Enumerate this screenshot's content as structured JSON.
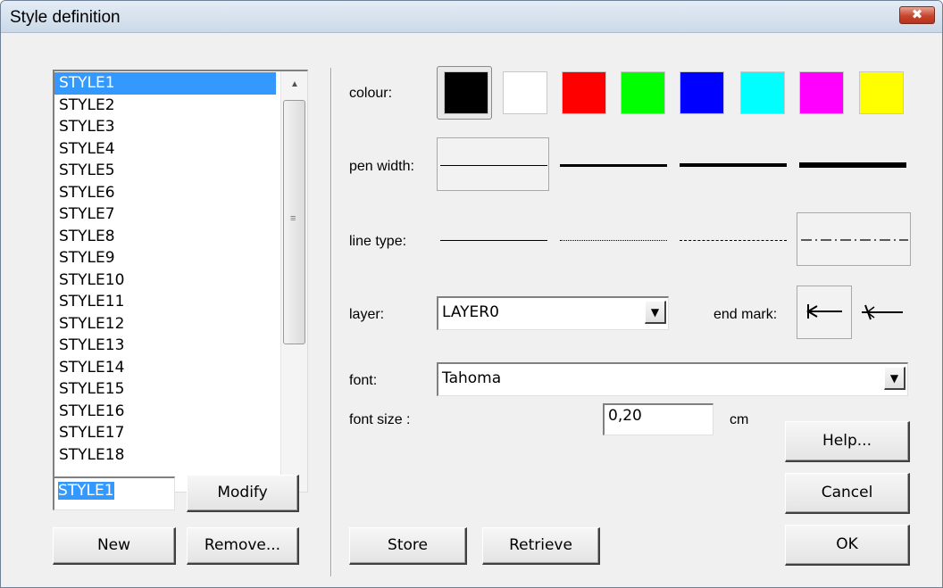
{
  "window": {
    "title": "Style definition",
    "close_glyph": "✖"
  },
  "styles_list": {
    "items": [
      "STYLE1",
      "STYLE2",
      "STYLE3",
      "STYLE4",
      "STYLE5",
      "STYLE6",
      "STYLE7",
      "STYLE8",
      "STYLE9",
      "STYLE10",
      "STYLE11",
      "STYLE12",
      "STYLE13",
      "STYLE14",
      "STYLE15",
      "STYLE16",
      "STYLE17",
      "STYLE18"
    ],
    "selected_index": 0
  },
  "name_field": {
    "value": "STYLE1"
  },
  "buttons": {
    "modify": "Modify",
    "new": "New",
    "remove": "Remove...",
    "store": "Store",
    "retrieve": "Retrieve",
    "help": "Help...",
    "cancel": "Cancel",
    "ok": "OK"
  },
  "labels": {
    "colour": "colour:",
    "pen_width": "pen width:",
    "line_type": "line type:",
    "layer": "layer:",
    "end_mark": "end mark:",
    "font": "font:",
    "font_size": "font size :",
    "cm": "cm"
  },
  "colours": [
    "#000000",
    "#ffffff",
    "#ff0000",
    "#00ff00",
    "#0000ff",
    "#00ffff",
    "#ff00ff",
    "#ffff00"
  ],
  "selected_colour": "#000000",
  "pen_widths": [
    1,
    3,
    4,
    6
  ],
  "selected_pen_width_index": 0,
  "line_types": [
    "solid",
    "dotted",
    "dashed",
    "dash-dot"
  ],
  "selected_line_type_index": 3,
  "layer": {
    "value": "LAYER0"
  },
  "font": {
    "value": "Tahoma"
  },
  "font_size": {
    "value": "0,20"
  }
}
